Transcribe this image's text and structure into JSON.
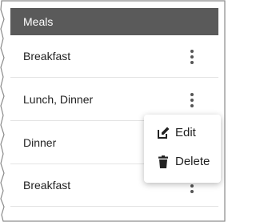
{
  "table": {
    "header": "Meals",
    "rows": [
      {
        "label": "Breakfast"
      },
      {
        "label": "Lunch, Dinner"
      },
      {
        "label": "Dinner"
      },
      {
        "label": "Breakfast"
      }
    ]
  },
  "context_menu": {
    "items": [
      {
        "label": "Edit",
        "icon": "edit-icon"
      },
      {
        "label": "Delete",
        "icon": "trash-icon"
      }
    ]
  },
  "colors": {
    "header_bg": "#5a5a5a",
    "header_text": "#ffffff",
    "row_divider": "#e4e4e4",
    "icon": "#555555"
  }
}
